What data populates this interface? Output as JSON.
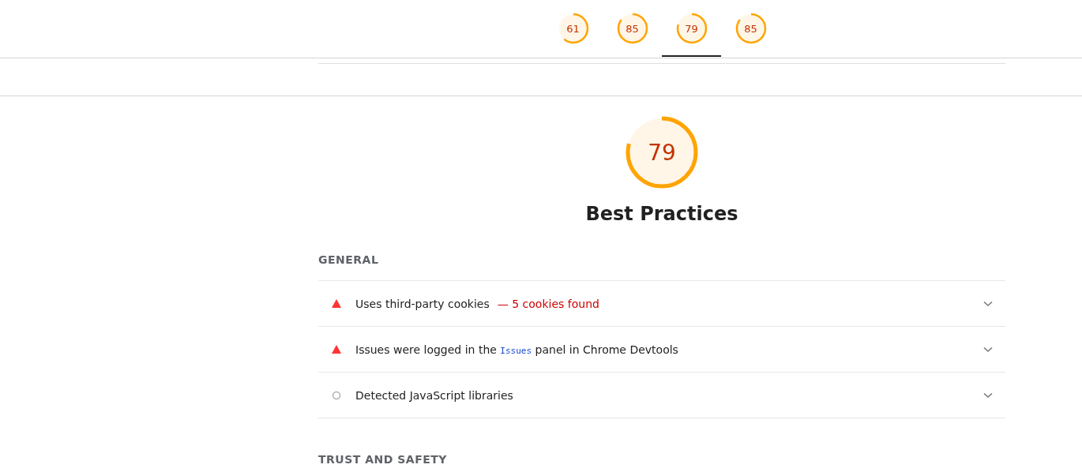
{
  "score_tabs": [
    {
      "score": "61",
      "selected": false
    },
    {
      "score": "85",
      "selected": false
    },
    {
      "score": "79",
      "selected": true
    },
    {
      "score": "85",
      "selected": false
    }
  ],
  "category": {
    "score": "79",
    "title": "Best Practices"
  },
  "groups": [
    {
      "title": "GENERAL",
      "audits": [
        {
          "kind": "fail",
          "title": [
            {
              "text": "Uses third-party cookies"
            }
          ],
          "display_value": "— 5 cookies found"
        },
        {
          "kind": "fail",
          "title": [
            {
              "text": "Issues were logged in the "
            },
            {
              "text": "Issues",
              "code": true
            },
            {
              "text": " panel in Chrome Devtools"
            }
          ]
        },
        {
          "kind": "info",
          "title": [
            {
              "text": "Detected JavaScript libraries"
            }
          ]
        }
      ]
    },
    {
      "title": "TRUST AND SAFETY"
    }
  ]
}
